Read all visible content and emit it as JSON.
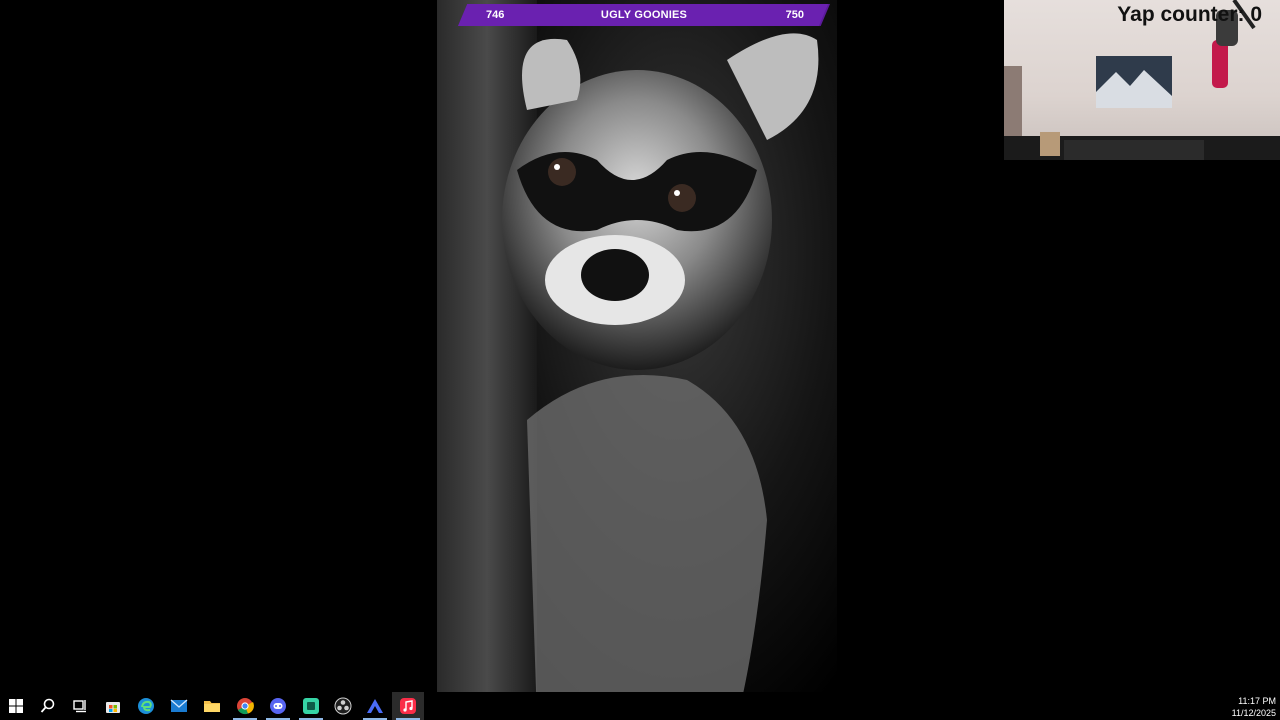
{
  "overlay": {
    "left_count": "746",
    "title": "UGLY GOONIES",
    "right_count": "750",
    "progress": 0.995,
    "accent": "#5b1a9a"
  },
  "webcam": {
    "yap_counter": "Yap counter: 0"
  },
  "taskbar": {
    "start_icon": "windows-start-icon",
    "items": [
      {
        "name": "search-icon"
      },
      {
        "name": "task-view-icon"
      },
      {
        "name": "microsoft-store-icon"
      },
      {
        "name": "edge-icon"
      },
      {
        "name": "mail-icon"
      },
      {
        "name": "file-explorer-icon"
      },
      {
        "name": "chrome-icon"
      },
      {
        "name": "discord-icon"
      },
      {
        "name": "app-icon"
      },
      {
        "name": "obs-icon"
      },
      {
        "name": "app-icon-blue"
      },
      {
        "name": "apple-music-icon"
      }
    ],
    "time": "11:17 PM",
    "date": "11/12/2025"
  }
}
